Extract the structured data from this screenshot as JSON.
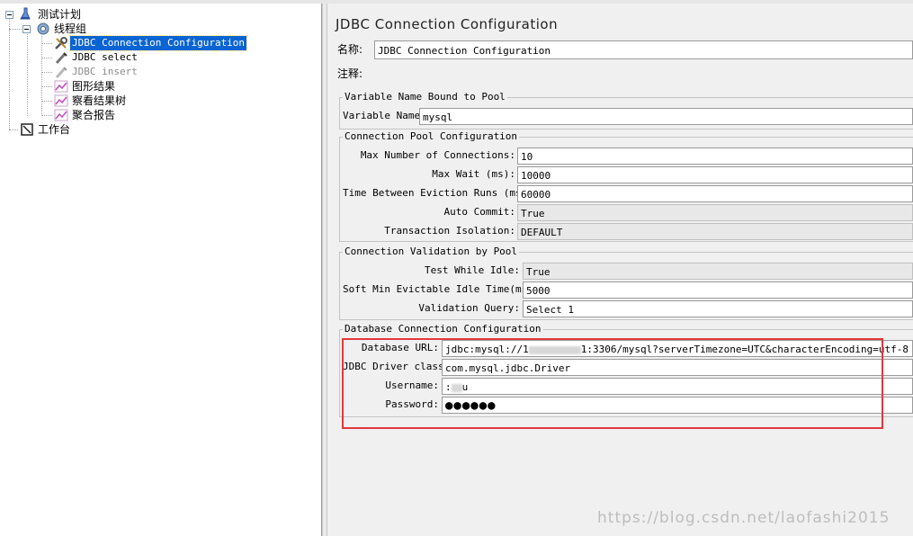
{
  "tree": {
    "test_plan": "测试计划",
    "thread_group": "线程组",
    "items": [
      {
        "label": "JDBC Connection Configuration",
        "icon": "wrench-icon",
        "selected": true
      },
      {
        "label": "JDBC select",
        "icon": "pipette-icon"
      },
      {
        "label": "JDBC insert",
        "icon": "pipette-icon",
        "disabled": true
      },
      {
        "label": "图形结果",
        "icon": "graph-icon"
      },
      {
        "label": "察看结果树",
        "icon": "graph-icon"
      },
      {
        "label": "聚合报告",
        "icon": "graph-icon"
      }
    ],
    "workbench": "工作台"
  },
  "panel": {
    "title": "JDBC Connection Configuration",
    "name_label": "名称:",
    "name_value": "JDBC Connection Configuration",
    "comment_label": "注释:",
    "group_var": {
      "legend": "Variable Name Bound to Pool",
      "var_label": "Variable Name:",
      "var_value": "mysql"
    },
    "group_pool": {
      "legend": "Connection Pool Configuration",
      "rows": [
        {
          "label": "Max Number of Connections:",
          "value": "10"
        },
        {
          "label": "Max Wait (ms):",
          "value": "10000"
        },
        {
          "label": "Time Between Eviction Runs (ms):",
          "value": "60000"
        },
        {
          "label": "Auto Commit:",
          "value": "True"
        },
        {
          "label": "Transaction Isolation:",
          "value": "DEFAULT"
        }
      ]
    },
    "group_validation": {
      "legend": "Connection Validation by Pool",
      "rows": [
        {
          "label": "Test While Idle:",
          "value": "True"
        },
        {
          "label": "Soft Min Evictable Idle Time(ms):",
          "value": "5000"
        },
        {
          "label": "Validation Query:",
          "value": "Select 1"
        }
      ]
    },
    "group_db": {
      "legend": "Database Connection Configuration",
      "url_label": "Database URL:",
      "url_prefix": "jdbc:mysql://1",
      "url_mid": "1",
      "url_suffix": ":3306/mysql?serverTimezone=UTC&characterEncoding=utf-8",
      "driver_label": "JDBC Driver class:",
      "driver_value": "com.mysql.jdbc.Driver",
      "user_label": "Username:",
      "user_prefix": ":",
      "user_suffix": "u",
      "pass_label": "Password:",
      "pass_value": "●●●●●●"
    }
  },
  "watermark": "https://blog.csdn.net/laofashi2015",
  "colors": {
    "selection": "#0a64d2",
    "highlight_box": "#e0393e"
  }
}
